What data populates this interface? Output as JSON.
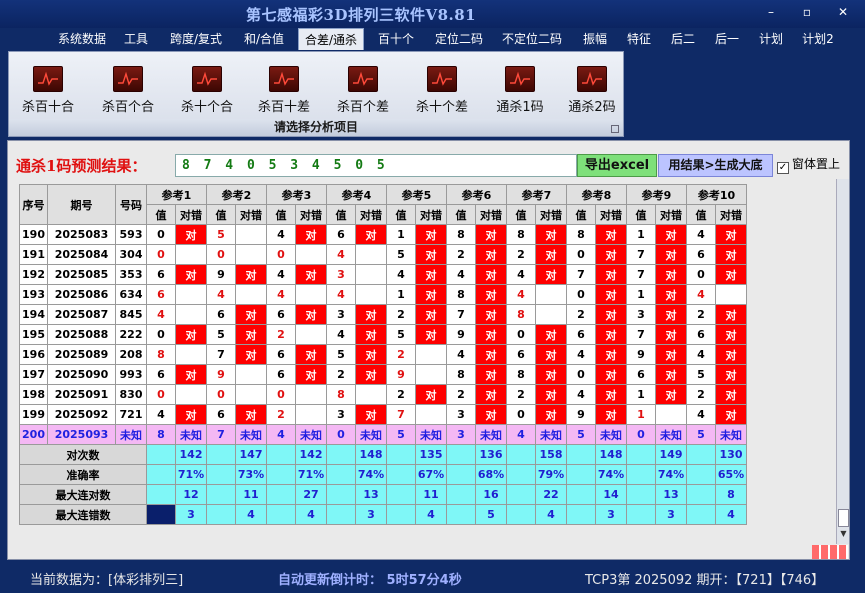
{
  "app": {
    "title": "第七感福彩3D排列三软件V8.81"
  },
  "window_controls": {
    "minimize": "–",
    "maximize": "▫",
    "close": "✕"
  },
  "menu": {
    "tabs": [
      {
        "label": "系统数据"
      },
      {
        "label": "工具"
      },
      {
        "label": "跨度/复式"
      },
      {
        "label": "和/合值"
      },
      {
        "label": "合差/通杀"
      },
      {
        "label": "百十个"
      },
      {
        "label": "定位二码"
      },
      {
        "label": "不定位二码"
      },
      {
        "label": "振幅"
      },
      {
        "label": "特征"
      },
      {
        "label": "后二"
      },
      {
        "label": "后一"
      },
      {
        "label": "计划"
      },
      {
        "label": "计划2"
      }
    ],
    "active": "合差/通杀"
  },
  "ribbon": {
    "buttons": [
      {
        "label": "杀百十合",
        "icon": "chart-icon"
      },
      {
        "label": "杀百个合",
        "icon": "chart-icon"
      },
      {
        "label": "杀十个合",
        "icon": "chart-icon"
      },
      {
        "label": "杀百十差",
        "icon": "chart-icon"
      },
      {
        "label": "杀百个差",
        "icon": "chart-icon"
      },
      {
        "label": "杀十个差",
        "icon": "chart-icon"
      },
      {
        "label": "通杀1码",
        "icon": "chart-icon"
      },
      {
        "label": "通杀2码",
        "icon": "chart-icon"
      }
    ],
    "caption": "请选择分析项目"
  },
  "prediction": {
    "label": "通杀1码预测结果：",
    "value": "8 7 4 0 5 3 4 5 0 5",
    "export_button": "导出excel",
    "generate_button": "用结果>生成大底",
    "pin_checkbox": {
      "label": "窗体置上",
      "checked": true
    }
  },
  "table": {
    "headers": {
      "seq": "序号",
      "period": "期号",
      "code": "号码",
      "refs": [
        "参考1",
        "参考2",
        "参考3",
        "参考4",
        "参考5",
        "参考6",
        "参考7",
        "参考8",
        "参考9",
        "参考10"
      ],
      "val": "值",
      "dc": "对错"
    },
    "mark_correct": "对",
    "rows": [
      {
        "seq": "190",
        "period": "2025083",
        "code": "593",
        "cells": [
          [
            "0",
            1
          ],
          [
            "5",
            0
          ],
          [
            "4",
            1
          ],
          [
            "6",
            1
          ],
          [
            "1",
            1
          ],
          [
            "8",
            1
          ],
          [
            "8",
            1
          ],
          [
            "8",
            1
          ],
          [
            "1",
            1
          ],
          [
            "4",
            1
          ]
        ]
      },
      {
        "seq": "191",
        "period": "2025084",
        "code": "304",
        "cells": [
          [
            "0",
            0
          ],
          [
            "0",
            0
          ],
          [
            "0",
            0
          ],
          [
            "4",
            0
          ],
          [
            "5",
            1
          ],
          [
            "2",
            1
          ],
          [
            "2",
            1
          ],
          [
            "0",
            1
          ],
          [
            "7",
            1
          ],
          [
            "6",
            1
          ]
        ]
      },
      {
        "seq": "192",
        "period": "2025085",
        "code": "353",
        "cells": [
          [
            "6",
            1
          ],
          [
            "9",
            1
          ],
          [
            "4",
            1
          ],
          [
            "3",
            0
          ],
          [
            "4",
            1
          ],
          [
            "4",
            1
          ],
          [
            "4",
            1
          ],
          [
            "7",
            1
          ],
          [
            "7",
            1
          ],
          [
            "0",
            1
          ]
        ]
      },
      {
        "seq": "193",
        "period": "2025086",
        "code": "634",
        "cells": [
          [
            "6",
            0
          ],
          [
            "4",
            0
          ],
          [
            "4",
            0
          ],
          [
            "4",
            0
          ],
          [
            "1",
            1
          ],
          [
            "8",
            1
          ],
          [
            "4",
            0
          ],
          [
            "0",
            1
          ],
          [
            "1",
            1
          ],
          [
            "4",
            0
          ]
        ]
      },
      {
        "seq": "194",
        "period": "2025087",
        "code": "845",
        "cells": [
          [
            "4",
            0
          ],
          [
            "6",
            1
          ],
          [
            "6",
            1
          ],
          [
            "3",
            1
          ],
          [
            "2",
            1
          ],
          [
            "7",
            1
          ],
          [
            "8",
            0
          ],
          [
            "2",
            1
          ],
          [
            "3",
            1
          ],
          [
            "2",
            1
          ]
        ]
      },
      {
        "seq": "195",
        "period": "2025088",
        "code": "222",
        "cells": [
          [
            "0",
            1
          ],
          [
            "5",
            1
          ],
          [
            "2",
            0
          ],
          [
            "4",
            1
          ],
          [
            "5",
            1
          ],
          [
            "9",
            1
          ],
          [
            "0",
            1
          ],
          [
            "6",
            1
          ],
          [
            "7",
            1
          ],
          [
            "6",
            1
          ]
        ]
      },
      {
        "seq": "196",
        "period": "2025089",
        "code": "208",
        "cells": [
          [
            "8",
            0
          ],
          [
            "7",
            1
          ],
          [
            "6",
            1
          ],
          [
            "5",
            1
          ],
          [
            "2",
            0
          ],
          [
            "4",
            1
          ],
          [
            "6",
            1
          ],
          [
            "4",
            1
          ],
          [
            "9",
            1
          ],
          [
            "4",
            1
          ]
        ]
      },
      {
        "seq": "197",
        "period": "2025090",
        "code": "993",
        "cells": [
          [
            "6",
            1
          ],
          [
            "9",
            0
          ],
          [
            "6",
            1
          ],
          [
            "2",
            1
          ],
          [
            "9",
            0
          ],
          [
            "8",
            1
          ],
          [
            "8",
            1
          ],
          [
            "0",
            1
          ],
          [
            "6",
            1
          ],
          [
            "5",
            1
          ]
        ]
      },
      {
        "seq": "198",
        "period": "2025091",
        "code": "830",
        "cells": [
          [
            "0",
            0
          ],
          [
            "0",
            0
          ],
          [
            "0",
            0
          ],
          [
            "8",
            0
          ],
          [
            "2",
            1
          ],
          [
            "2",
            1
          ],
          [
            "2",
            1
          ],
          [
            "4",
            1
          ],
          [
            "1",
            1
          ],
          [
            "2",
            1
          ]
        ]
      },
      {
        "seq": "199",
        "period": "2025092",
        "code": "721",
        "cells": [
          [
            "4",
            1
          ],
          [
            "6",
            1
          ],
          [
            "2",
            0
          ],
          [
            "3",
            1
          ],
          [
            "7",
            0
          ],
          [
            "3",
            1
          ],
          [
            "0",
            1
          ],
          [
            "9",
            1
          ],
          [
            "1",
            0
          ],
          [
            "4",
            1
          ]
        ]
      }
    ],
    "future": {
      "seq": "200",
      "period": "2025093",
      "code": "未知",
      "values": [
        "8",
        "7",
        "4",
        "0",
        "5",
        "3",
        "4",
        "5",
        "0",
        "5"
      ],
      "unknown": "未知"
    },
    "stats": [
      {
        "label": "对次数",
        "values": [
          "142",
          "147",
          "142",
          "148",
          "135",
          "136",
          "158",
          "148",
          "149",
          "130"
        ]
      },
      {
        "label": "准确率",
        "values": [
          "71%",
          "73%",
          "71%",
          "74%",
          "67%",
          "68%",
          "79%",
          "74%",
          "74%",
          "65%"
        ]
      },
      {
        "label": "最大连对数",
        "values": [
          "12",
          "11",
          "27",
          "13",
          "11",
          "16",
          "22",
          "14",
          "13",
          "8"
        ]
      },
      {
        "label": "最大连错数",
        "values": [
          "3",
          "4",
          "4",
          "3",
          "4",
          "5",
          "4",
          "3",
          "3",
          "4"
        ]
      }
    ]
  },
  "status": {
    "current_data": "当前数据为：[体彩排列三]",
    "countdown": "自动更新倒计时：  5时57分4秒",
    "draw_info": "TCP3第  2025092 期开：【721】【746】"
  },
  "colors": {
    "correct": "#ff0000",
    "stat_bg": "#7ff7f7",
    "future_bg": "#f4b8f4",
    "title": "#a9c4ff"
  }
}
